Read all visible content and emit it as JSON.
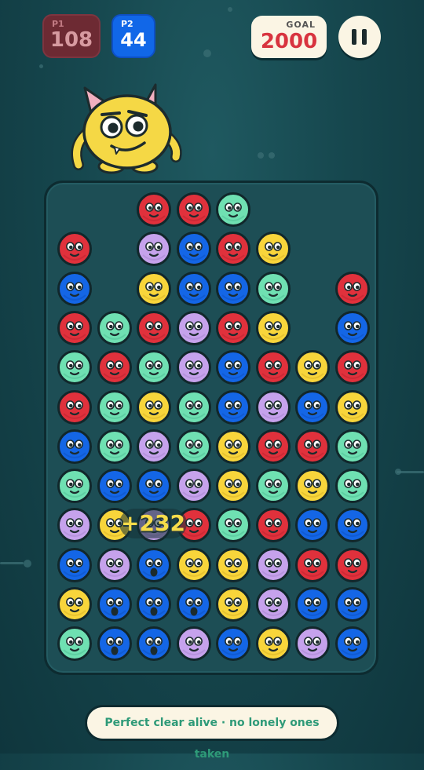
{
  "scores": {
    "p1": {
      "label": "P1",
      "value": "108"
    },
    "p2": {
      "label": "P2",
      "value": "44"
    }
  },
  "goal": {
    "label": "GOAL",
    "value": "2000"
  },
  "pause_icon": "pause-icon",
  "mascot_icon": "yellow-horned-monster-icon",
  "colors": {
    "red": "#e0313c",
    "blue": "#1466e6",
    "green": "#6fe0b2",
    "yellow": "#f8d53b",
    "purple": "#c6a2ec",
    "goal_text": "#d8343f",
    "status_text": "#2e9a78"
  },
  "board": {
    "columns": 8,
    "rows": [
      [
        "",
        "",
        "red",
        "red",
        "green",
        "",
        "",
        ""
      ],
      [
        "red",
        "",
        "purple",
        "blue",
        "red",
        "yellow",
        "",
        ""
      ],
      [
        "blue",
        "",
        "yellow",
        "blue",
        "blue",
        "green",
        "",
        "red"
      ],
      [
        "red",
        "green",
        "red",
        "purple",
        "red",
        "yellow",
        "",
        "blue"
      ],
      [
        "green",
        "red",
        "green",
        "purple",
        "blue",
        "red",
        "yellow",
        "red"
      ],
      [
        "red",
        "green",
        "yellow",
        "green",
        "blue",
        "purple",
        "blue",
        "yellow"
      ],
      [
        "blue",
        "green",
        "purple",
        "green",
        "yellow",
        "red",
        "red",
        "green"
      ],
      [
        "green",
        "blue",
        "blue",
        "purple",
        "yellow",
        "green",
        "yellow",
        "green"
      ],
      [
        "purple",
        "yellow",
        "purple",
        "red",
        "green",
        "red",
        "blue",
        "blue"
      ],
      [
        "blue",
        "purple",
        "blue*",
        "yellow",
        "yellow",
        "purple",
        "red",
        "red"
      ],
      [
        "yellow",
        "blue*",
        "blue*",
        "blue*",
        "yellow",
        "purple",
        "blue",
        "blue"
      ],
      [
        "green",
        "blue*",
        "blue*",
        "purple",
        "blue",
        "yellow",
        "purple",
        "blue"
      ]
    ]
  },
  "popup": {
    "text": "+232"
  },
  "status": {
    "text": "Perfect clear alive · no lonely ones taken"
  }
}
